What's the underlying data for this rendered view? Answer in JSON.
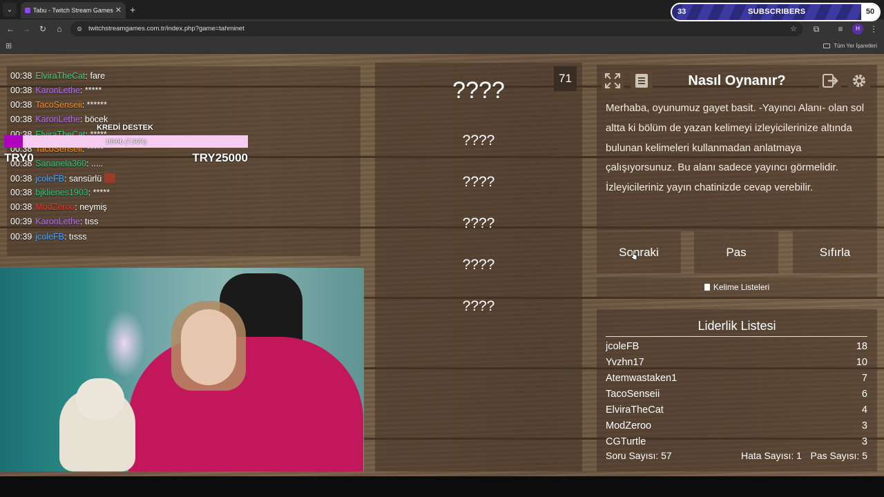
{
  "browser": {
    "tab_title": "Tabu - Twitch Stream Games",
    "url": "twitchstreamgames.com.tr/index.php?game=tahminet",
    "bookmarks_all": "Tüm Yer İşaretleri",
    "profile_initial": "H"
  },
  "subs_widget": {
    "left_count": "33",
    "label": "SUBSCRIBERS",
    "right_count": "50"
  },
  "chat": {
    "messages": [
      {
        "time": "00:38",
        "user": "ElviraTheCat",
        "color": "#3fd17a",
        "text": ": fare"
      },
      {
        "time": "00:38",
        "user": "KaronLethe",
        "color": "#b36bff",
        "text": ": *****"
      },
      {
        "time": "00:38",
        "user": "TacoSenseii",
        "color": "#ff8c1a",
        "text": ": ******"
      },
      {
        "time": "00:38",
        "user": "KaronLethe",
        "color": "#b36bff",
        "text": ": böcek"
      },
      {
        "time": "00:38",
        "user": "ElviraTheCat",
        "color": "#3fd17a",
        "text": ": *****"
      },
      {
        "time": "00:38",
        "user": "TacoSenseii",
        "color": "#ff8c1a",
        "text": ": *****"
      },
      {
        "time": "00:38",
        "user": "Sananela360",
        "color": "#2ec27e",
        "text": ": ....."
      },
      {
        "time": "00:38",
        "user": "jcoleFB",
        "color": "#4aa3ff",
        "text": ": sansürlü"
      },
      {
        "time": "00:38",
        "user": "bjklienes1903",
        "color": "#2ec27e",
        "text": ": *****"
      },
      {
        "time": "00:38",
        "user": "ModZeroo",
        "color": "#ff2a2a",
        "text": ": neymiş"
      },
      {
        "time": "00:39",
        "user": "KaronLethe",
        "color": "#b36bff",
        "text": ": tıss"
      },
      {
        "time": "00:39",
        "user": "jcoleFB",
        "color": "#4aa3ff",
        "text": ": tısss"
      }
    ]
  },
  "kredi": {
    "title": "KREDİ DESTEK",
    "bar_label": "1890₺ (7.56%)",
    "progress_percent": 7.56,
    "min": "TRY0",
    "max": "TRY25000"
  },
  "game": {
    "timer": "71",
    "main_word": "????",
    "taboo_words": [
      "????",
      "????",
      "????",
      "????",
      "????"
    ]
  },
  "howto": {
    "title": "Nasıl Oynanır?",
    "text": "Merhaba, oyunumuz gayet basit. -Yayıncı Alanı- olan sol altta ki bölüm de yazan kelimeyi izleyicilerinize altında bulunan kelimeleri kullanmadan anlatmaya çalışıyorsunuz. Bu alanı sadece yayıncı görmelidir. İzleyicileriniz yayın chatinizde cevap verebilir."
  },
  "actions": {
    "next": "Sonraki",
    "pass": "Pas",
    "reset": "Sıfırla",
    "word_lists": "Kelime Listeleri"
  },
  "leaderboard": {
    "title": "Liderlik Listesi",
    "rows": [
      {
        "name": "jcoleFB",
        "score": "18"
      },
      {
        "name": "Yvzhn17",
        "score": "10"
      },
      {
        "name": "Atemwastaken1",
        "score": "7"
      },
      {
        "name": "TacoSenseii",
        "score": "6"
      },
      {
        "name": "ElviraTheCat",
        "score": "4"
      },
      {
        "name": "ModZeroo",
        "score": "3"
      },
      {
        "name": "CGTurtle",
        "score": "3"
      }
    ]
  },
  "stats": {
    "questions": "Soru Sayısı: 57",
    "errors": "Hata Sayısı: 1",
    "passes": "Pas Sayısı: 5"
  }
}
